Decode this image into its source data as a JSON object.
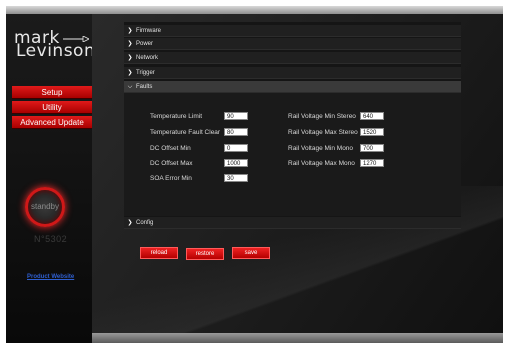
{
  "brand": {
    "line1": "mark",
    "line2": "Levinson",
    "reg": "®"
  },
  "nav": [
    {
      "label": "Setup"
    },
    {
      "label": "Utility"
    },
    {
      "label": "Advanced Update"
    }
  ],
  "status": {
    "standby": "standby",
    "model": "N°5302"
  },
  "links": {
    "product_website": "Product Website"
  },
  "sections": {
    "firmware": "Firmware",
    "power": "Power",
    "network": "Network",
    "trigger": "Trigger",
    "faults": "Faults",
    "config": "Config"
  },
  "faults": {
    "left": [
      {
        "label": "Temperature Limit",
        "value": "90"
      },
      {
        "label": "Temperature Fault Clear",
        "value": "80"
      },
      {
        "label": "DC Offset Min",
        "value": "0"
      },
      {
        "label": "DC Offset Max",
        "value": "1000"
      },
      {
        "label": "SOA Error Min",
        "value": "30"
      }
    ],
    "right": [
      {
        "label": "Rail Voltage Min Stereo",
        "value": "640"
      },
      {
        "label": "Rail Voltage Max Stereo",
        "value": "1520"
      },
      {
        "label": "Rail Voltage Min Mono",
        "value": "700"
      },
      {
        "label": "Rail Voltage Max Mono",
        "value": "1270"
      }
    ]
  },
  "actions": {
    "reload": "reload",
    "restore": "restore",
    "save": "save"
  },
  "colors": {
    "accent": "#d01818",
    "link": "#2f5fd0",
    "panel": "#151515"
  }
}
